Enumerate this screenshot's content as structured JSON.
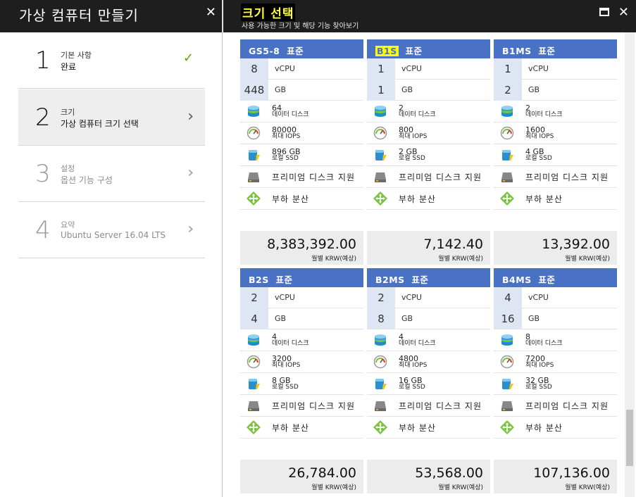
{
  "wizard": {
    "title": "가상 컴퓨터 만들기",
    "steps": [
      {
        "num": "1",
        "label": "기본 사항",
        "sub": "완료"
      },
      {
        "num": "2",
        "label": "크기",
        "sub": "가상 컴퓨터 크기 선택"
      },
      {
        "num": "3",
        "label": "설정",
        "sub": "옵션 기능 구성"
      },
      {
        "num": "4",
        "label": "요약",
        "sub": "Ubuntu Server 16.04 LTS"
      }
    ]
  },
  "panel": {
    "title": "크기 선택",
    "subtitle": "사용 가능한 크기 및 해당 기능 찾아보기"
  },
  "labels": {
    "vcpu": "vCPU",
    "gb": "GB",
    "disks": "데이터 디스크",
    "iops": "최대 IOPS",
    "ssd": "로컬 SSD",
    "premium": "프리미엄 디스크 지원",
    "lb": "부하 분산",
    "price_note": "월별 KRW(예상)"
  },
  "cards": [
    {
      "name": "GS5-8",
      "tier": "표준",
      "vcpu": "8",
      "gb": "448",
      "disks": "64",
      "iops": "80000",
      "ssd": "896 GB",
      "price": "8,383,392.00"
    },
    {
      "name": "B1S",
      "tier": "표준",
      "vcpu": "1",
      "gb": "1",
      "disks": "2",
      "iops": "800",
      "ssd": "2 GB",
      "price": "7,142.40"
    },
    {
      "name": "B1MS",
      "tier": "표준",
      "vcpu": "1",
      "gb": "2",
      "disks": "2",
      "iops": "1600",
      "ssd": "4 GB",
      "price": "13,392.00"
    },
    {
      "name": "B2S",
      "tier": "표준",
      "vcpu": "2",
      "gb": "4",
      "disks": "4",
      "iops": "3200",
      "ssd": "8 GB",
      "price": "26,784.00"
    },
    {
      "name": "B2MS",
      "tier": "표준",
      "vcpu": "2",
      "gb": "8",
      "disks": "4",
      "iops": "4800",
      "ssd": "16 GB",
      "price": "53,568.00"
    },
    {
      "name": "B4MS",
      "tier": "표준",
      "vcpu": "4",
      "gb": "16",
      "disks": "8",
      "iops": "7200",
      "ssd": "32 GB",
      "price": "107,136.00"
    }
  ],
  "colors": {
    "card_header": "#4a72c4",
    "title_highlight": "#ffff33",
    "check": "#5aa700"
  }
}
